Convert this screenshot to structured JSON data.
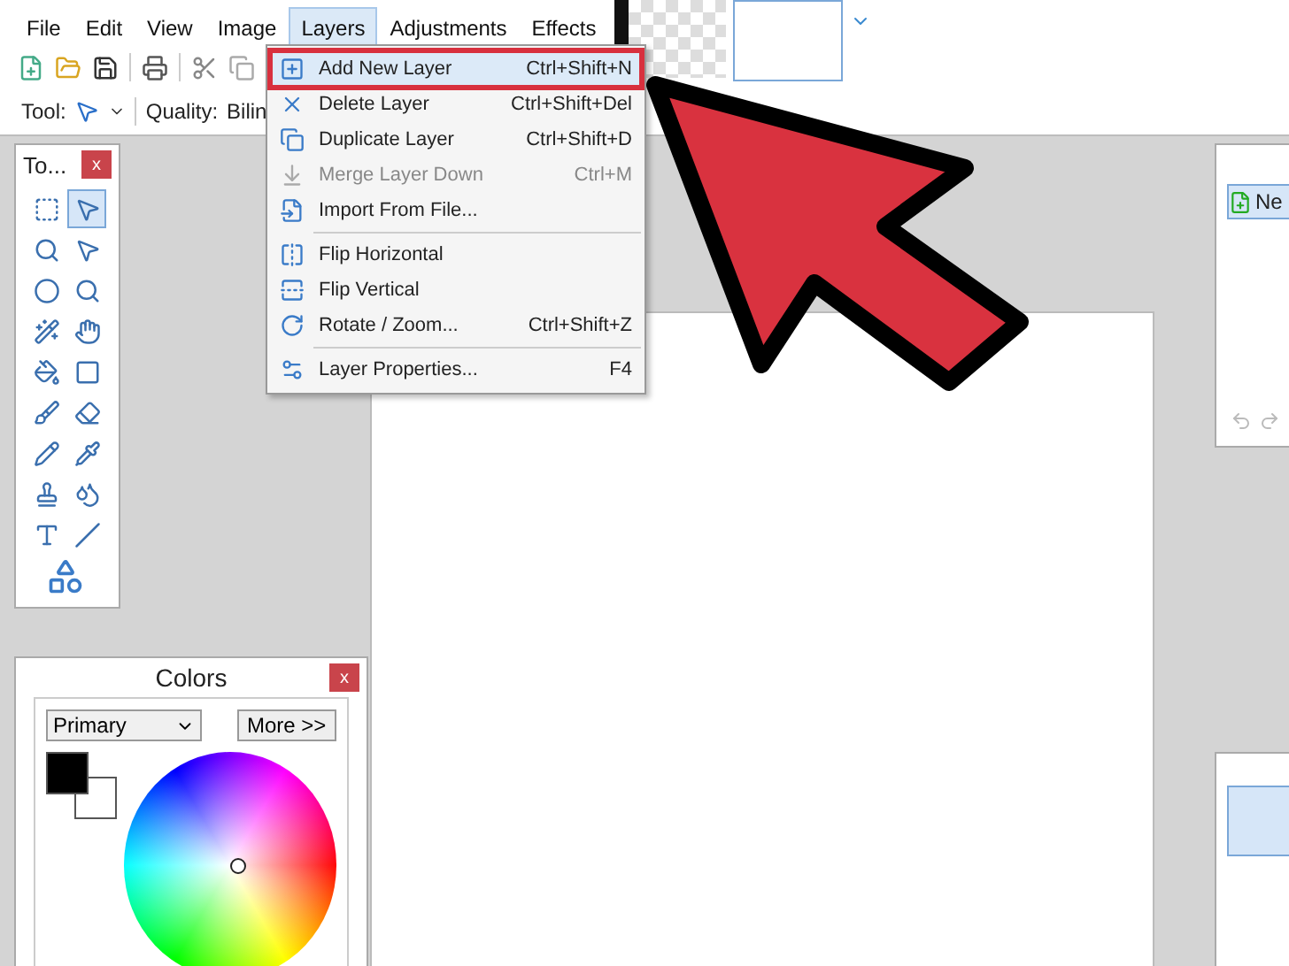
{
  "menu_bar": [
    {
      "label": "File",
      "selected": false
    },
    {
      "label": "Edit",
      "selected": false
    },
    {
      "label": "View",
      "selected": false
    },
    {
      "label": "Image",
      "selected": false
    },
    {
      "label": "Layers",
      "selected": true
    },
    {
      "label": "Adjustments",
      "selected": false
    },
    {
      "label": "Effects",
      "selected": false
    }
  ],
  "toolbar": {
    "tool_label": "Tool:",
    "quality_label": "Quality:",
    "quality_value": "Bilin"
  },
  "layers_menu": [
    [
      {
        "label": "Add New Layer",
        "shortcut": "Ctrl+Shift+N",
        "selected": true,
        "disabled": false
      },
      {
        "label": "Delete Layer",
        "shortcut": "Ctrl+Shift+Del",
        "selected": false,
        "disabled": false
      },
      {
        "label": "Duplicate Layer",
        "shortcut": "Ctrl+Shift+D",
        "selected": false,
        "disabled": false
      },
      {
        "label": "Merge Layer Down",
        "shortcut": "Ctrl+M",
        "selected": false,
        "disabled": true
      },
      {
        "label": "Import From File...",
        "selected": false,
        "disabled": false
      }
    ],
    [
      {
        "label": "Flip Horizontal",
        "selected": false,
        "disabled": false
      },
      {
        "label": "Flip Vertical",
        "selected": false,
        "disabled": false
      },
      {
        "label": "Rotate / Zoom...",
        "shortcut": "Ctrl+Shift+Z",
        "selected": false,
        "disabled": false
      }
    ],
    [
      {
        "label": "Layer Properties...",
        "shortcut": "F4",
        "selected": false,
        "disabled": false
      }
    ]
  ],
  "tools_window": {
    "title": "To...",
    "close": "x",
    "tools": [
      {
        "selected": false
      },
      {
        "selected": true
      },
      {
        "selected": false
      },
      {
        "selected": false
      },
      {
        "selected": false
      },
      {
        "selected": false
      },
      {
        "selected": false
      },
      {
        "selected": false
      },
      {
        "selected": false
      },
      {
        "selected": false
      },
      {
        "selected": false
      },
      {
        "selected": false
      },
      {
        "selected": false
      },
      {
        "selected": false
      },
      {
        "selected": false
      },
      {
        "selected": false
      },
      {
        "selected": false
      },
      {
        "selected": false
      },
      {
        "selected": false
      }
    ]
  },
  "colors_window": {
    "title": "Colors",
    "close": "x",
    "mode": "Primary",
    "more_button": "More >>"
  },
  "history_window": {
    "item": "Ne"
  }
}
